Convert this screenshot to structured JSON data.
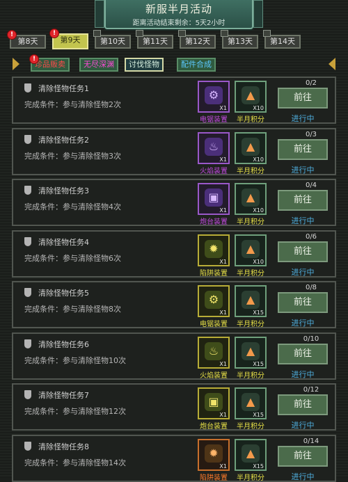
{
  "header": {
    "title": "新服半月活动",
    "subtitle": "距离活动结束剩余：5天2小时"
  },
  "days": [
    {
      "label": "第8天",
      "alert": "!",
      "active": false
    },
    {
      "label": "第9天",
      "alert": "!",
      "active": true
    },
    {
      "label": "第10天",
      "alert": "",
      "active": false
    },
    {
      "label": "第11天",
      "alert": "",
      "active": false
    },
    {
      "label": "第12天",
      "alert": "",
      "active": false
    },
    {
      "label": "第13天",
      "alert": "",
      "active": false
    },
    {
      "label": "第14天",
      "alert": "",
      "active": false
    }
  ],
  "categories": [
    {
      "label": "珍品贩卖",
      "color": "#ff4a4a",
      "alert": "!"
    },
    {
      "label": "无尽深渊",
      "color": "#ff4ad8",
      "alert": ""
    },
    {
      "label": "讨伐怪物",
      "color": "#d8f1e0",
      "alert": "",
      "active": true
    },
    {
      "label": "配件合成",
      "color": "#5cc8ff",
      "alert": ""
    }
  ],
  "tasks": [
    {
      "title": "清除怪物任务1",
      "condition": "完成条件：参与清除怪物2次",
      "r1_label": "电锯装置",
      "r1_style": "purple",
      "r1_icon": "⚙",
      "r1_count": "X1",
      "r1_color": "#c24ae0",
      "r2_label": "半月积分",
      "r2_count": "X10",
      "progress": "0/2",
      "button": "前往",
      "status": "进行中"
    },
    {
      "title": "清除怪物任务2",
      "condition": "完成条件：参与清除怪物3次",
      "r1_label": "火焰装置",
      "r1_style": "purple",
      "r1_icon": "♨",
      "r1_count": "X1",
      "r1_color": "#c24ae0",
      "r2_label": "半月积分",
      "r2_count": "X10",
      "progress": "0/3",
      "button": "前往",
      "status": "进行中"
    },
    {
      "title": "清除怪物任务3",
      "condition": "完成条件：参与清除怪物4次",
      "r1_label": "炮台装置",
      "r1_style": "purple",
      "r1_icon": "▣",
      "r1_count": "X1",
      "r1_color": "#c24ae0",
      "r2_label": "半月积分",
      "r2_count": "X10",
      "progress": "0/4",
      "button": "前往",
      "status": "进行中"
    },
    {
      "title": "清除怪物任务4",
      "condition": "完成条件：参与清除怪物6次",
      "r1_label": "陷阱装置",
      "r1_style": "yellow",
      "r1_icon": "✹",
      "r1_count": "X1",
      "r1_color": "#e6e048",
      "r2_label": "半月积分",
      "r2_count": "X10",
      "progress": "0/6",
      "button": "前往",
      "status": "进行中"
    },
    {
      "title": "清除怪物任务5",
      "condition": "完成条件：参与清除怪物8次",
      "r1_label": "电锯装置",
      "r1_style": "yellow",
      "r1_icon": "⚙",
      "r1_count": "X1",
      "r1_color": "#e6e048",
      "r2_label": "半月积分",
      "r2_count": "X15",
      "progress": "0/8",
      "button": "前往",
      "status": "进行中"
    },
    {
      "title": "清除怪物任务6",
      "condition": "完成条件：参与清除怪物10次",
      "r1_label": "火焰装置",
      "r1_style": "yellow",
      "r1_icon": "♨",
      "r1_count": "X1",
      "r1_color": "#e6e048",
      "r2_label": "半月积分",
      "r2_count": "X15",
      "progress": "0/10",
      "button": "前往",
      "status": "进行中"
    },
    {
      "title": "清除怪物任务7",
      "condition": "完成条件：参与清除怪物12次",
      "r1_label": "炮台装置",
      "r1_style": "yellow",
      "r1_icon": "▣",
      "r1_count": "X1",
      "r1_color": "#e6e048",
      "r2_label": "半月积分",
      "r2_count": "X15",
      "progress": "0/12",
      "button": "前往",
      "status": "进行中"
    },
    {
      "title": "清除怪物任务8",
      "condition": "完成条件：参与清除怪物14次",
      "r1_label": "陷阱装置",
      "r1_style": "orange",
      "r1_icon": "✹",
      "r1_count": "X1",
      "r1_color": "#ff7a2a",
      "r2_label": "半月积分",
      "r2_count": "X15",
      "progress": "0/14",
      "button": "前往",
      "status": "进行中"
    }
  ]
}
